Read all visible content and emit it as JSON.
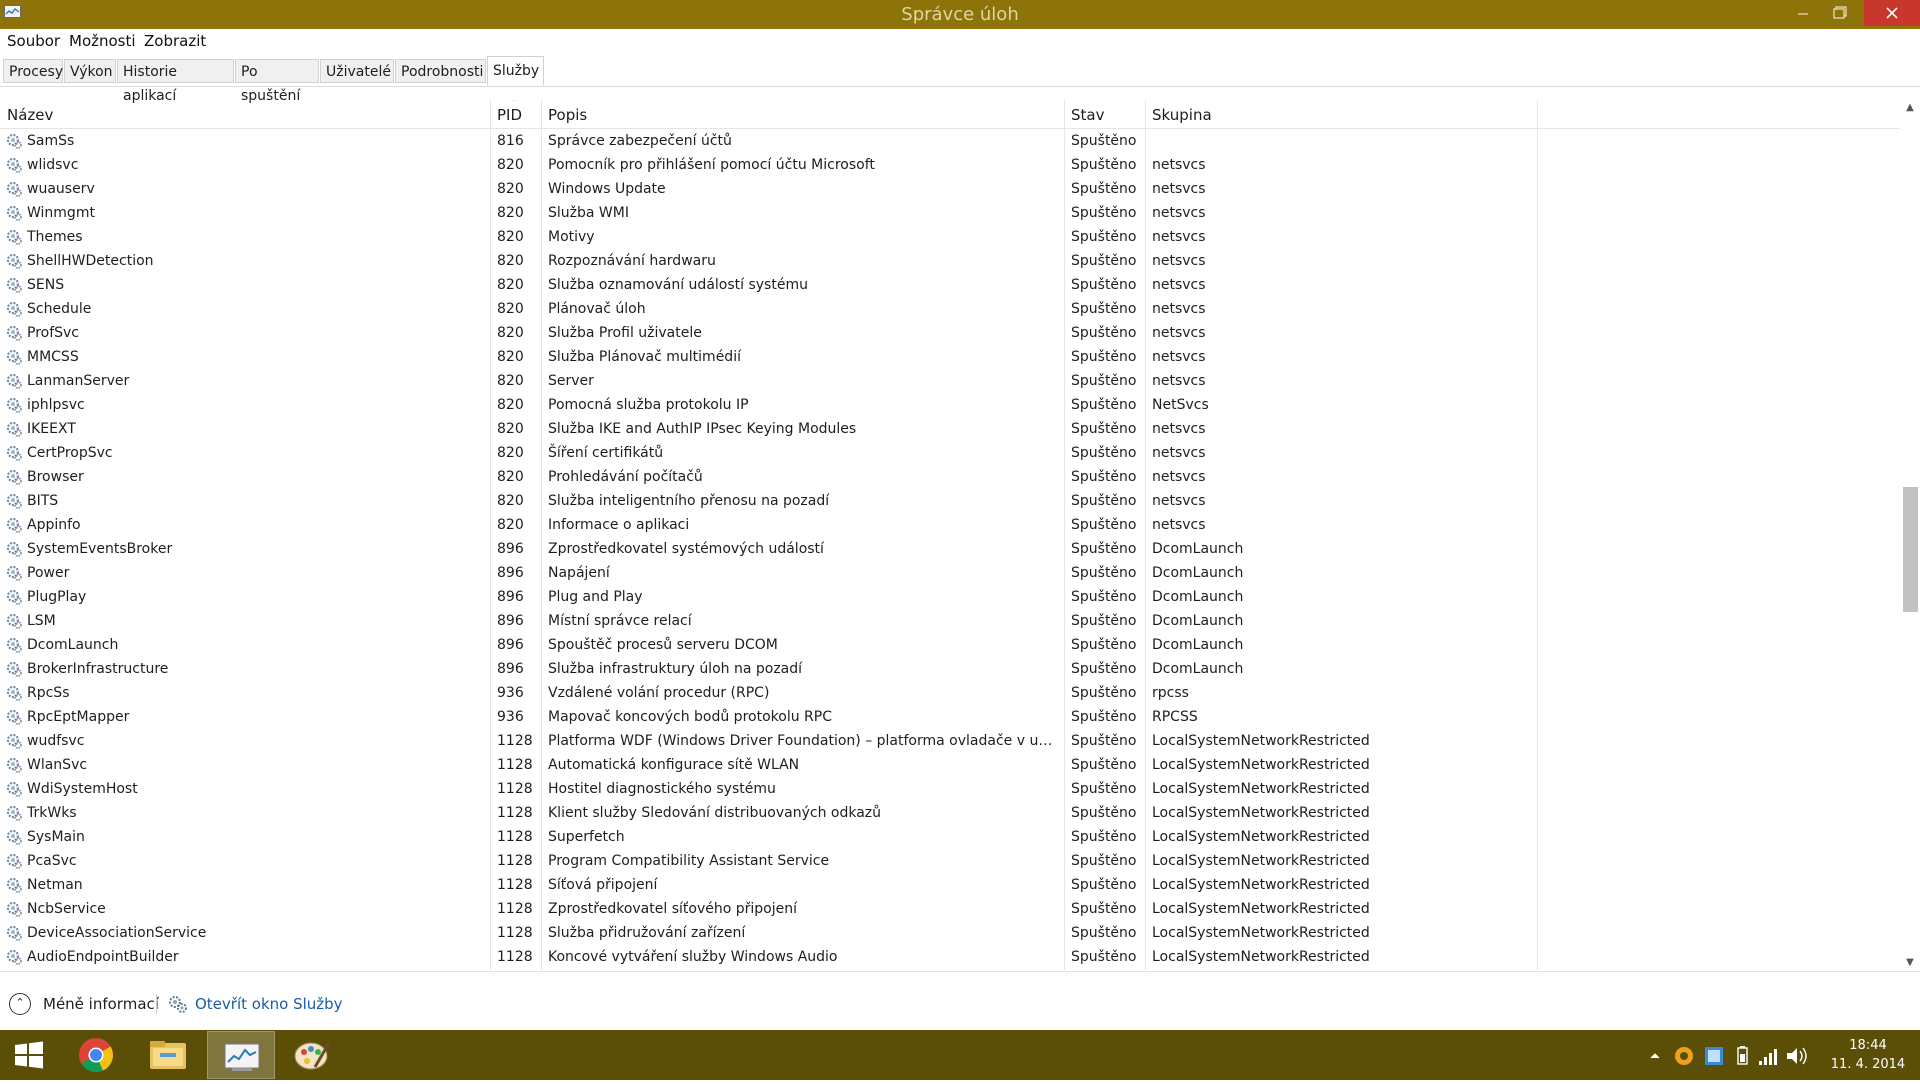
{
  "window": {
    "title": "Správce úloh"
  },
  "menu": [
    {
      "label": "Soubor"
    },
    {
      "label": "Možnosti"
    },
    {
      "label": "Zobrazit"
    }
  ],
  "tabs": [
    {
      "label": "Procesy",
      "active": false
    },
    {
      "label": "Výkon",
      "active": false
    },
    {
      "label": "Historie aplikací",
      "active": false
    },
    {
      "label": "Po spuštění",
      "active": false
    },
    {
      "label": "Uživatelé",
      "active": false
    },
    {
      "label": "Podrobnosti",
      "active": false
    },
    {
      "label": "Služby",
      "active": true
    }
  ],
  "table": {
    "columns": {
      "name": "Název",
      "pid": "PID",
      "desc": "Popis",
      "status": "Stav",
      "group": "Skupina"
    },
    "sorted_by": "PID",
    "sort_direction": "ascending",
    "rows": [
      {
        "name": "SamSs",
        "pid": "816",
        "desc": "Správce zabezpečení účtů",
        "status": "Spuštěno",
        "group": ""
      },
      {
        "name": "wlidsvc",
        "pid": "820",
        "desc": "Pomocník pro přihlášení pomocí účtu Microsoft",
        "status": "Spuštěno",
        "group": "netsvcs"
      },
      {
        "name": "wuauserv",
        "pid": "820",
        "desc": "Windows Update",
        "status": "Spuštěno",
        "group": "netsvcs"
      },
      {
        "name": "Winmgmt",
        "pid": "820",
        "desc": "Služba WMI",
        "status": "Spuštěno",
        "group": "netsvcs"
      },
      {
        "name": "Themes",
        "pid": "820",
        "desc": "Motivy",
        "status": "Spuštěno",
        "group": "netsvcs"
      },
      {
        "name": "ShellHWDetection",
        "pid": "820",
        "desc": "Rozpoznávání hardwaru",
        "status": "Spuštěno",
        "group": "netsvcs"
      },
      {
        "name": "SENS",
        "pid": "820",
        "desc": "Služba oznamování událostí systému",
        "status": "Spuštěno",
        "group": "netsvcs"
      },
      {
        "name": "Schedule",
        "pid": "820",
        "desc": "Plánovač úloh",
        "status": "Spuštěno",
        "group": "netsvcs"
      },
      {
        "name": "ProfSvc",
        "pid": "820",
        "desc": "Služba Profil uživatele",
        "status": "Spuštěno",
        "group": "netsvcs"
      },
      {
        "name": "MMCSS",
        "pid": "820",
        "desc": "Služba Plánovač multimédií",
        "status": "Spuštěno",
        "group": "netsvcs"
      },
      {
        "name": "LanmanServer",
        "pid": "820",
        "desc": "Server",
        "status": "Spuštěno",
        "group": "netsvcs"
      },
      {
        "name": "iphlpsvc",
        "pid": "820",
        "desc": "Pomocná služba protokolu IP",
        "status": "Spuštěno",
        "group": "NetSvcs"
      },
      {
        "name": "IKEEXT",
        "pid": "820",
        "desc": "Služba IKE and AuthIP IPsec Keying Modules",
        "status": "Spuštěno",
        "group": "netsvcs"
      },
      {
        "name": "CertPropSvc",
        "pid": "820",
        "desc": "Šíření certifikátů",
        "status": "Spuštěno",
        "group": "netsvcs"
      },
      {
        "name": "Browser",
        "pid": "820",
        "desc": "Prohledávání počítačů",
        "status": "Spuštěno",
        "group": "netsvcs"
      },
      {
        "name": "BITS",
        "pid": "820",
        "desc": "Služba inteligentního přenosu na pozadí",
        "status": "Spuštěno",
        "group": "netsvcs"
      },
      {
        "name": "Appinfo",
        "pid": "820",
        "desc": "Informace o aplikaci",
        "status": "Spuštěno",
        "group": "netsvcs"
      },
      {
        "name": "SystemEventsBroker",
        "pid": "896",
        "desc": "Zprostředkovatel systémových událostí",
        "status": "Spuštěno",
        "group": "DcomLaunch"
      },
      {
        "name": "Power",
        "pid": "896",
        "desc": "Napájení",
        "status": "Spuštěno",
        "group": "DcomLaunch"
      },
      {
        "name": "PlugPlay",
        "pid": "896",
        "desc": "Plug and Play",
        "status": "Spuštěno",
        "group": "DcomLaunch"
      },
      {
        "name": "LSM",
        "pid": "896",
        "desc": "Místní správce relací",
        "status": "Spuštěno",
        "group": "DcomLaunch"
      },
      {
        "name": "DcomLaunch",
        "pid": "896",
        "desc": "Spouštěč procesů serveru DCOM",
        "status": "Spuštěno",
        "group": "DcomLaunch"
      },
      {
        "name": "BrokerInfrastructure",
        "pid": "896",
        "desc": "Služba infrastruktury úloh na pozadí",
        "status": "Spuštěno",
        "group": "DcomLaunch"
      },
      {
        "name": "RpcSs",
        "pid": "936",
        "desc": "Vzdálené volání procedur (RPC)",
        "status": "Spuštěno",
        "group": "rpcss"
      },
      {
        "name": "RpcEptMapper",
        "pid": "936",
        "desc": "Mapovač koncových bodů protokolu RPC",
        "status": "Spuštěno",
        "group": "RPCSS"
      },
      {
        "name": "wudfsvc",
        "pid": "1128",
        "desc": "Platforma WDF (Windows Driver Foundation) – platforma ovladače v uživat...",
        "status": "Spuštěno",
        "group": "LocalSystemNetworkRestricted"
      },
      {
        "name": "WlanSvc",
        "pid": "1128",
        "desc": "Automatická konfigurace sítě WLAN",
        "status": "Spuštěno",
        "group": "LocalSystemNetworkRestricted"
      },
      {
        "name": "WdiSystemHost",
        "pid": "1128",
        "desc": "Hostitel diagnostického systému",
        "status": "Spuštěno",
        "group": "LocalSystemNetworkRestricted"
      },
      {
        "name": "TrkWks",
        "pid": "1128",
        "desc": "Klient služby Sledování distribuovaných odkazů",
        "status": "Spuštěno",
        "group": "LocalSystemNetworkRestricted"
      },
      {
        "name": "SysMain",
        "pid": "1128",
        "desc": "Superfetch",
        "status": "Spuštěno",
        "group": "LocalSystemNetworkRestricted"
      },
      {
        "name": "PcaSvc",
        "pid": "1128",
        "desc": "Program Compatibility Assistant Service",
        "status": "Spuštěno",
        "group": "LocalSystemNetworkRestricted"
      },
      {
        "name": "Netman",
        "pid": "1128",
        "desc": "Síťová připojení",
        "status": "Spuštěno",
        "group": "LocalSystemNetworkRestricted"
      },
      {
        "name": "NcbService",
        "pid": "1128",
        "desc": "Zprostředkovatel síťového připojení",
        "status": "Spuštěno",
        "group": "LocalSystemNetworkRestricted"
      },
      {
        "name": "DeviceAssociationService",
        "pid": "1128",
        "desc": "Služba přidružování zařízení",
        "status": "Spuštěno",
        "group": "LocalSystemNetworkRestricted"
      },
      {
        "name": "AudioEndpointBuilder",
        "pid": "1128",
        "desc": "Koncové vytváření služby Windows Audio",
        "status": "Spuštěno",
        "group": "LocalSystemNetworkRestricted"
      }
    ]
  },
  "scroll": {
    "position_fraction": 0.52,
    "visible_fraction": 0.15
  },
  "footer": {
    "less_info": "Méně informací",
    "open_services": "Otevřít okno Služby"
  },
  "taskbar": {
    "apps": [
      {
        "icon": "chrome-icon",
        "active": false
      },
      {
        "icon": "file-explorer-icon",
        "active": false
      },
      {
        "icon": "task-manager-icon",
        "active": true
      },
      {
        "icon": "paint-icon",
        "active": false
      }
    ],
    "clock": {
      "time": "18:44",
      "date": "11. 4. 2014"
    }
  },
  "colors": {
    "titlebar": "#8e730a",
    "taskbar": "#5b4f07",
    "close_button": "#c7372c",
    "link": "#1a5ca8"
  }
}
